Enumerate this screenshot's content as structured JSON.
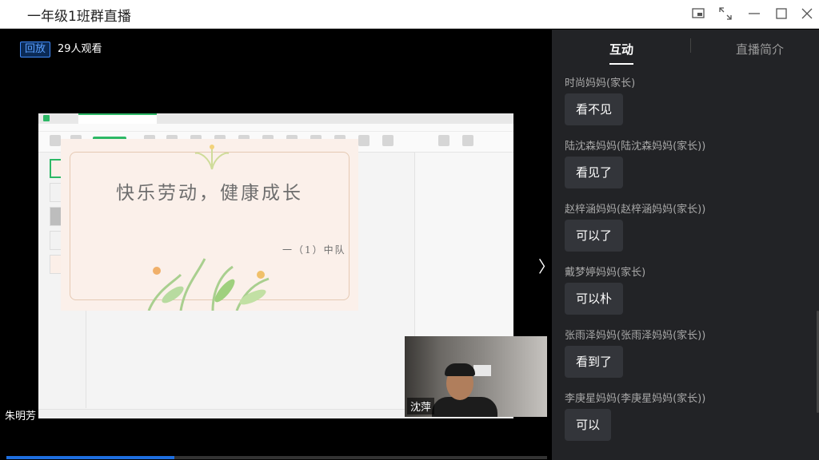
{
  "window": {
    "title": "一年级1班群直播",
    "controls": [
      "picture-in-picture-icon",
      "fullscreen-icon",
      "minimize-icon",
      "maximize-icon",
      "close-icon"
    ]
  },
  "player": {
    "replay_badge": "回放",
    "viewers": "29人观看",
    "presenter_name": "朱明芳",
    "progress_fraction": 0.31,
    "next_arrow": "〉"
  },
  "slide": {
    "title": "快乐劳动，健康成长",
    "subtitle": "一（1）中队"
  },
  "webcam": {
    "name": "沈萍"
  },
  "side_panel": {
    "tabs": [
      {
        "label": "互动",
        "active": true
      },
      {
        "label": "直播简介",
        "active": false
      }
    ],
    "messages": [
      {
        "name": "时尚妈妈(家长)",
        "text": "看不见"
      },
      {
        "name": "陆沈森妈妈(陆沈森妈妈(家长))",
        "text": "看见了"
      },
      {
        "name": "赵梓涵妈妈(赵梓涵妈妈(家长))",
        "text": "可以了"
      },
      {
        "name": "戴梦婷妈妈(家长)",
        "text": "可以朴"
      },
      {
        "name": "张雨泽妈妈(张雨泽妈妈(家长))",
        "text": "看到了"
      },
      {
        "name": "李庚星妈妈(李庚星妈妈(家长))",
        "text": "可以"
      }
    ]
  },
  "colors": {
    "accent": "#1e6fe0",
    "panel_bg": "#222326",
    "bubble_bg": "#33353a"
  }
}
